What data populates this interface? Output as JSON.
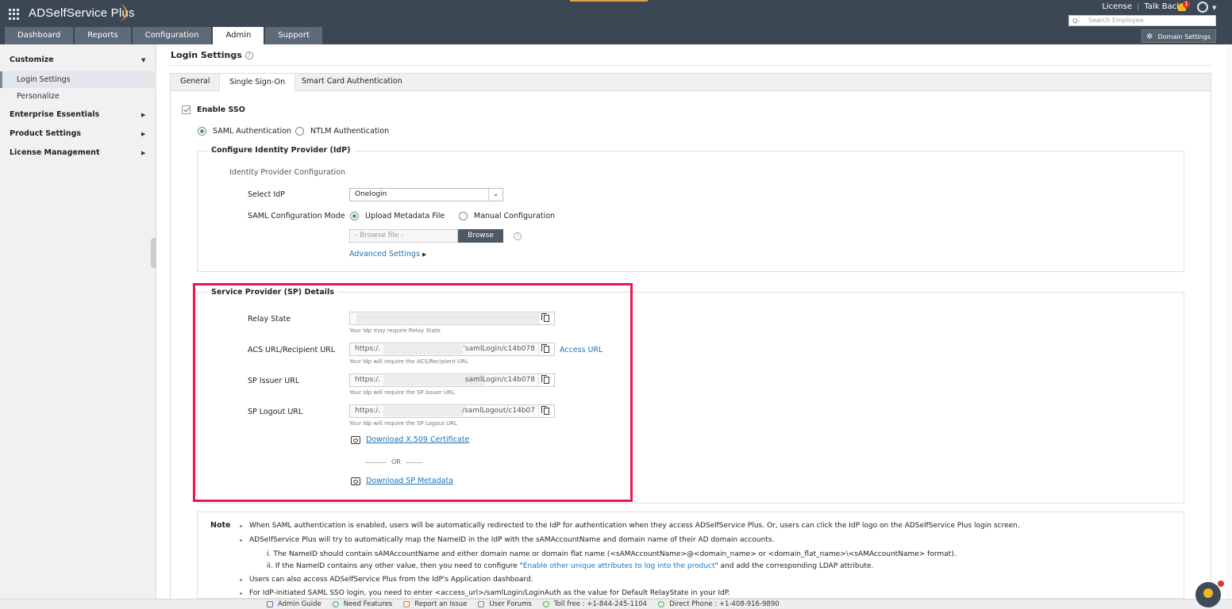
{
  "app": {
    "name": "ADSelfService Plus"
  },
  "header": {
    "links": [
      "License",
      "Talk Back"
    ],
    "notification_count": "1",
    "search_placeholder": "Search Employee",
    "domain_settings": "Domain Settings"
  },
  "tabs": [
    "Dashboard",
    "Reports",
    "Configuration",
    "Admin",
    "Support"
  ],
  "active_tab": "Admin",
  "sidebar": {
    "customize": "Customize",
    "login_settings": "Login Settings",
    "personalize": "Personalize",
    "enterprise": "Enterprise Essentials",
    "product": "Product Settings",
    "license": "License Management"
  },
  "page": {
    "title": "Login Settings",
    "subtabs": [
      "General",
      "Single Sign-On",
      "Smart Card Authentication"
    ],
    "enable_sso": "Enable SSO",
    "saml_auth": "SAML Authentication",
    "ntlm_auth": "NTLM Authentication",
    "idp_section": "Configure Identity Provider (IdP)",
    "idp_config": "Identity Provider Configuration",
    "select_idp_label": "Select IdP",
    "select_idp_value": "Onelogin",
    "saml_mode_label": "SAML Configuration Mode",
    "upload_metadata": "Upload Metadata File",
    "manual_config": "Manual Configuration",
    "browse_placeholder": "- Browse file -",
    "browse_btn": "Browse",
    "advanced": "Advanced Settings",
    "sp_section": "Service Provider (SP) Details",
    "relay_state": "Relay State",
    "relay_hint": "Your Idp may require Relay State",
    "acs_label": "ACS URL/Recipient URL",
    "acs_prefix": "https:/.",
    "acs_suffix": "'samlLogin/c14b078",
    "acs_hint": "Your Idp will require the ACS/Recipient URL",
    "access_url": "Access URL",
    "issuer_label": "SP Issuer URL",
    "issuer_prefix": "https:/.",
    "issuer_suffix": "samlLogin/c14b078",
    "issuer_hint": "Your Idp will require the SP Issuer URL",
    "logout_label": "SP Logout URL",
    "logout_prefix": "https:/.",
    "logout_suffix": "/samlLogout/c14b07",
    "logout_hint": "Your Idp will require the SP Logout URL",
    "download_cert": "Download X.509 Certificate",
    "or": "OR",
    "download_meta": "Download SP Metadata"
  },
  "note": {
    "title": "Note",
    "line1": "When SAML authentication is enabled, users will be automatically redirected to the IdP for authentication when they access ADSelfService Plus. Or, users can click the IdP logo on the ADSelfService Plus login screen.",
    "line2": "ADSelfService Plus will try to automatically map the NameID in the IdP with the sAMAccountName and domain name of their AD domain accounts.",
    "line3": "i. The NameID should contain sAMAccountName and either domain name or domain flat name (<sAMAccountName>@<domain_name> or <domain_flat_name>\\<sAMAccountName> format).",
    "line4a": "ii. If the NameID contains any other value, then you need to configure \"",
    "line4link": "Enable other unique attributes to log into the product",
    "line4b": "\" and add the corresponding LDAP attribute.",
    "line5": "Users can also access ADSelfService Plus from the IdP's Application dashboard.",
    "line6": "For IdP-initiated SAML SSO login, you need to enter <access_url>/samlLogin/LoginAuth as the value for Default RelayState in your IdP."
  },
  "footer": {
    "admin_guide": "Admin Guide",
    "need_features": "Need Features",
    "report_issue": "Report an Issue",
    "user_forums": "User Forums",
    "toll_free": "Toll free : +1-844-245-1104",
    "direct_phone": "Direct Phone : +1-408-916-9890"
  },
  "colors": {
    "header_bg": "#3c4754",
    "highlight": "#e8184f",
    "link": "#1a73b8"
  }
}
